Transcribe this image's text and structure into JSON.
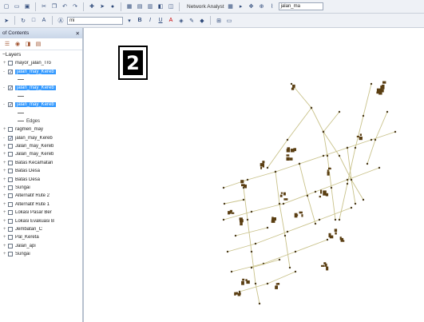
{
  "toolbar": {
    "network_analyst_label": "Network Analyst",
    "network_dataset_value": "jalan_ma",
    "field_value": "mi"
  },
  "toc": {
    "title": "of Contents",
    "layers_root": "Layers",
    "layers": [
      {
        "label": "mayor_jalan_Tro",
        "checked": false,
        "selected": false,
        "expander": "+"
      },
      {
        "label": "jalan_may_Kereb",
        "checked": true,
        "selected": true,
        "expander": "-"
      },
      {
        "label": "jalan_may_Kereb",
        "checked": true,
        "selected": true,
        "expander": "-"
      },
      {
        "label": "jalan_may_Kereb",
        "checked": true,
        "selected": true,
        "expander": "-"
      },
      {
        "label": "ragmen_may",
        "checked": false,
        "selected": false,
        "expander": "+"
      },
      {
        "label": "jalan_may_Kereb",
        "checked": true,
        "selected": false,
        "expander": "-"
      },
      {
        "label": "Jalan_may_Kereb",
        "checked": false,
        "selected": false,
        "expander": "+"
      },
      {
        "label": "Jalan_may_Kereb",
        "checked": false,
        "selected": false,
        "expander": "+"
      },
      {
        "label": "Batas Kecamatan",
        "checked": false,
        "selected": false,
        "expander": "+"
      },
      {
        "label": "Batas Desa",
        "checked": false,
        "selected": false,
        "expander": "+"
      },
      {
        "label": "Batas Desa",
        "checked": false,
        "selected": false,
        "expander": "+"
      },
      {
        "label": "Sungai",
        "checked": false,
        "selected": false,
        "expander": "+"
      },
      {
        "label": "Alternatif Rute 2",
        "checked": false,
        "selected": false,
        "expander": "+"
      },
      {
        "label": "Alternatif Rute 1",
        "checked": false,
        "selected": false,
        "expander": "+"
      },
      {
        "label": "Lokasi Pasar Ber",
        "checked": false,
        "selected": false,
        "expander": "+"
      },
      {
        "label": "Lokasi Evakuasi B",
        "checked": false,
        "selected": false,
        "expander": "+"
      },
      {
        "label": "Jembatan_C",
        "checked": false,
        "selected": false,
        "expander": "+"
      },
      {
        "label": "Pal_Kereta",
        "checked": false,
        "selected": false,
        "expander": "+"
      },
      {
        "label": "Jalan_api",
        "checked": false,
        "selected": false,
        "expander": "+"
      },
      {
        "label": "Sungai",
        "checked": false,
        "selected": false,
        "expander": "+"
      }
    ],
    "edges_label": "Edges"
  },
  "figure": {
    "badge": "2"
  }
}
